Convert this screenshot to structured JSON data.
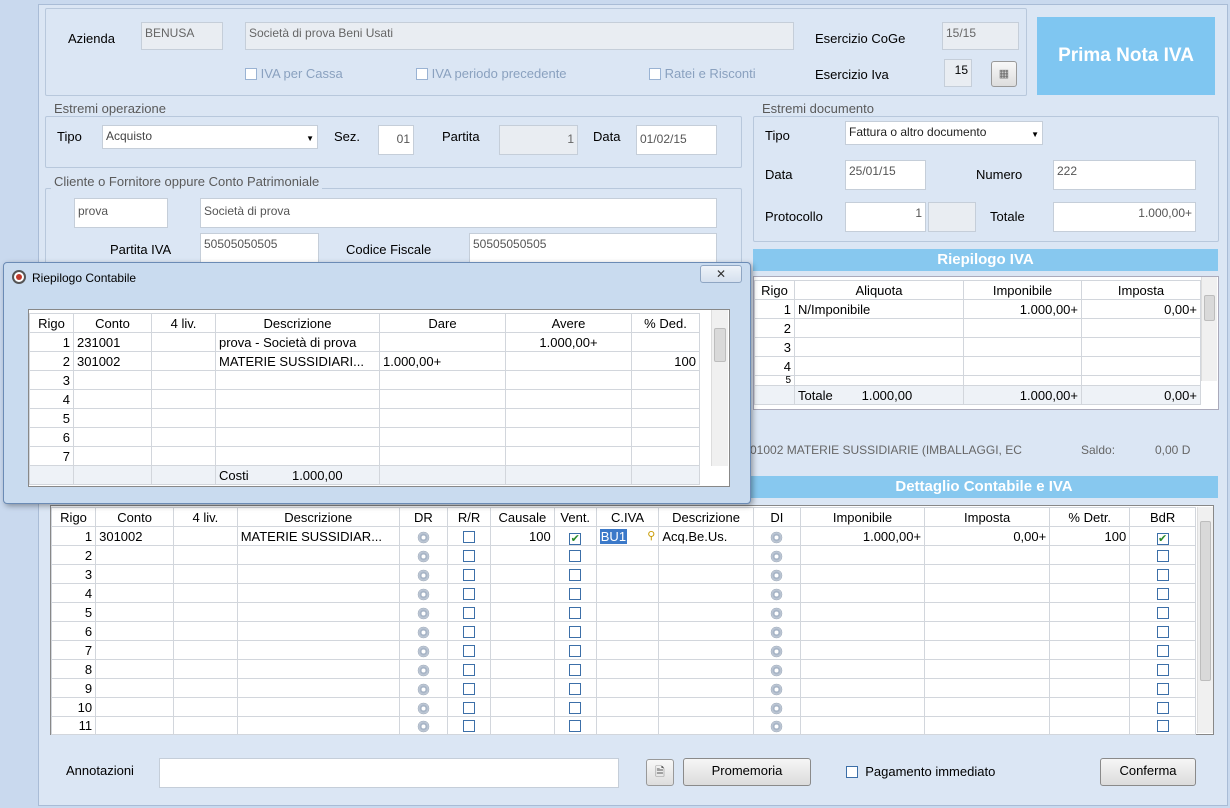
{
  "header": {
    "azienda_label": "Azienda",
    "azienda_code": "BENUSA",
    "azienda_name": "Società di prova Beni Usati",
    "iva_cassa": "IVA per Cassa",
    "iva_periodo": "IVA periodo precedente",
    "ratei": "Ratei e Risconti",
    "esercizio_coge_label": "Esercizio CoGe",
    "esercizio_coge": "15/15",
    "esercizio_iva_label": "Esercizio Iva",
    "esercizio_iva": "15",
    "title": "Prima Nota IVA"
  },
  "operazione": {
    "group": "Estremi operazione",
    "tipo_label": "Tipo",
    "tipo": "Acquisto",
    "sez_label": "Sez.",
    "sez": "01",
    "partita_label": "Partita",
    "partita": "1",
    "data_label": "Data",
    "data": "01/02/15"
  },
  "cliente": {
    "group": "Cliente o Fornitore oppure Conto Patrimoniale",
    "code": "prova",
    "name": "Società di prova",
    "piva_label": "Partita IVA",
    "piva": "50505050505",
    "cf_label": "Codice Fiscale",
    "cf": "50505050505"
  },
  "documento": {
    "group": "Estremi documento",
    "tipo_label": "Tipo",
    "tipo": "Fattura o altro documento",
    "data_label": "Data",
    "data": "25/01/15",
    "numero_label": "Numero",
    "numero": "222",
    "protocollo_label": "Protocollo",
    "protocollo": "1",
    "totale_label": "Totale",
    "totale": "1.000,00+"
  },
  "riepilogo_iva": {
    "title": "Riepilogo IVA",
    "headers": [
      "Rigo",
      "Aliquota",
      "Imponibile",
      "Imposta"
    ],
    "rows": [
      [
        "1",
        "N/Imponibile",
        "1.000,00+",
        "0,00+"
      ],
      [
        "2",
        "",
        "",
        ""
      ],
      [
        "3",
        "",
        "",
        ""
      ],
      [
        "4",
        "",
        "",
        ""
      ],
      [
        "5",
        "",
        "",
        ""
      ]
    ],
    "totale_label": "Totale",
    "totale_aliquota": "1.000,00",
    "totale_imponibile": "1.000,00+",
    "totale_imposta": "0,00+"
  },
  "conto_info": {
    "text": "01002  MATERIE SUSSIDIARIE (IMBALLAGGI, EC",
    "saldo_label": "Saldo:",
    "saldo": "0,00 D"
  },
  "dettaglio": {
    "title": "Dettaglio Contabile e IVA",
    "headers": [
      "Rigo",
      "Conto",
      "4 liv.",
      "Descrizione",
      "DR",
      "R/R",
      "Causale",
      "Vent.",
      "C.IVA",
      "Descrizione",
      "DI",
      "Imponibile",
      "Imposta",
      "% Detr.",
      "BdR"
    ],
    "rows": [
      {
        "rigo": "1",
        "conto": "301002",
        "liv": "",
        "descr": "MATERIE SUSSIDIAR...",
        "causale": "100",
        "vent": true,
        "civa": "BU1",
        "descr2": "Acq.Be.Us.",
        "imponibile": "1.000,00+",
        "imposta": "0,00+",
        "detr": "100",
        "bdr": true
      },
      {
        "rigo": "2"
      },
      {
        "rigo": "3"
      },
      {
        "rigo": "4"
      },
      {
        "rigo": "5"
      },
      {
        "rigo": "6"
      },
      {
        "rigo": "7"
      },
      {
        "rigo": "8"
      },
      {
        "rigo": "9"
      },
      {
        "rigo": "10"
      },
      {
        "rigo": "11"
      }
    ]
  },
  "footer": {
    "annotazioni_label": "Annotazioni",
    "annotazioni": "",
    "promemoria": "Promemoria",
    "pagamento": "Pagamento immediato",
    "conferma": "Conferma"
  },
  "popup": {
    "title": "Riepilogo Contabile",
    "close": "✕",
    "headers": [
      "Rigo",
      "Conto",
      "4 liv.",
      "Descrizione",
      "Dare",
      "Avere",
      "% Ded."
    ],
    "rows": [
      [
        "1",
        "231001",
        "",
        "prova  - Società di prova",
        "",
        "1.000,00+",
        ""
      ],
      [
        "2",
        "301002",
        "",
        "MATERIE SUSSIDIARI...",
        "1.000,00+",
        "",
        "100"
      ],
      [
        "3",
        "",
        "",
        "",
        "",
        "",
        ""
      ],
      [
        "4",
        "",
        "",
        "",
        "",
        "",
        ""
      ],
      [
        "5",
        "",
        "",
        "",
        "",
        "",
        ""
      ],
      [
        "6",
        "",
        "",
        "",
        "",
        "",
        ""
      ],
      [
        "7",
        "",
        "",
        "",
        "",
        "",
        ""
      ]
    ],
    "costi_label": "Costi",
    "costi_value": "1.000,00"
  }
}
